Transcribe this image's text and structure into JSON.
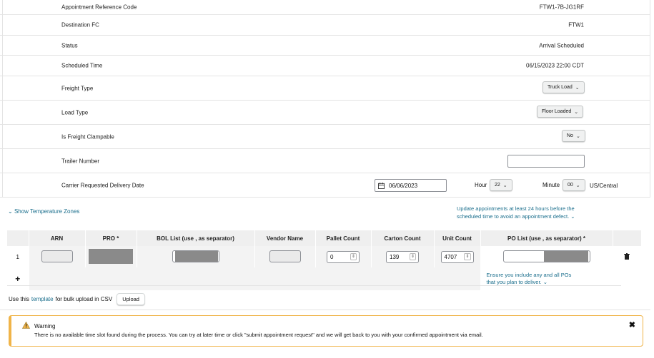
{
  "details": {
    "ref_label": "Appointment Reference Code",
    "ref_value": "FTW1-7B-JG1RF",
    "dest_label": "Destination FC",
    "dest_value": "FTW1",
    "status_label": "Status",
    "status_value": "Arrival Scheduled",
    "sched_label": "Scheduled Time",
    "sched_value": "06/15/2023 22:00 CDT",
    "freight_label": "Freight Type",
    "freight_value": "Truck Load",
    "load_label": "Load Type",
    "load_value": "Floor Loaded",
    "clamp_label": "Is Freight Clampable",
    "clamp_value": "No",
    "trailer_label": "Trailer Number",
    "trailer_value": "",
    "delivery_label": "Carrier Requested Delivery Date",
    "delivery_date": "06/06/2023",
    "hour_label": "Hour",
    "hour_value": "22",
    "minute_label": "Minute",
    "minute_value": "00",
    "timezone": "US/Central"
  },
  "temperature_link": "Show Temperature Zones",
  "update_notice_line1": "Update appointments at least 24 hours before the",
  "update_notice_line2": "scheduled time to avoid an appointment defect.",
  "table": {
    "headers": [
      "ARN",
      "PRO *",
      "BOL List (use , as separator)",
      "Vendor Name",
      "Pallet Count",
      "Carton Count",
      "Unit Count",
      "PO List (use , as separator) *"
    ],
    "row": {
      "index": "1",
      "pallet_count": "0",
      "carton_count": "139",
      "unit_count": "4707"
    },
    "add_symbol": "+",
    "po_hint_line1": "Ensure you include any and all POs",
    "po_hint_line2": "that you plan to deliver."
  },
  "bulk": {
    "prefix": "Use this",
    "link": "template",
    "suffix": "for bulk upload in CSV",
    "upload_label": "Upload"
  },
  "warning": {
    "title": "Warning",
    "message": "There is no available time slot found during the process. You can try at later time or click \"submit appointment request\" and we will get back to you with your confirmed appointment via email.",
    "color": "#f0b449"
  },
  "icons": {
    "calendar": "calendar-icon",
    "trash": "trash-icon",
    "warning": "warning-icon",
    "close": "close-icon",
    "chevron": "chevron-down-icon"
  }
}
